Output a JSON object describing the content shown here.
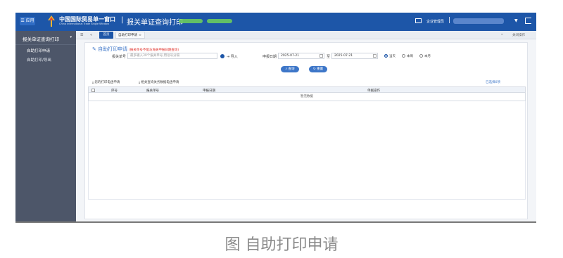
{
  "topbar": {
    "menu_label": "应用",
    "brand_cn": "中国国际贸易单一窗口",
    "brand_en": "China International Trade Single Window",
    "separator": "|",
    "module_title": "报关单证查询打印",
    "admin_label": "企业管理员",
    "separator2": "|",
    "caret": "▼"
  },
  "sidebar": {
    "heading": "报关单证查询打印",
    "items": [
      {
        "label": "自助打印申请"
      },
      {
        "label": "自助打印/导出"
      }
    ]
  },
  "tabbar": {
    "home_tab": "首页",
    "current_tab": "自助打印申请",
    "close_all": "关闭操作",
    "prev": "«",
    "next": "»"
  },
  "form": {
    "title": "自助打印申请",
    "note": "(报关单号不能与海关申报日期查询)",
    "decl_no_label": "报关单号",
    "decl_no_placeholder": "最多输入30个报关单号,用逗号分隔",
    "import_label": "导入",
    "date_label": "申报日期",
    "date_from": "2025-07-21",
    "date_to_label": "至",
    "date_to": "2025-07-21",
    "radio_options": [
      "当天",
      "本周",
      "本月"
    ],
    "radio_selected": "当天",
    "search_btn": "查询",
    "reset_btn": "重置"
  },
  "toolbar": {
    "links": [
      "您的打印电函申请",
      "相关查询关务数据电函申请"
    ],
    "selected_label": "已选择0项"
  },
  "table": {
    "columns": [
      "序号",
      "报关单号",
      "申报日期",
      "单据操作"
    ],
    "empty_text": "暂无数据"
  },
  "caption": "图 自助打印申请",
  "colors": {
    "primary": "#1d56a8",
    "sidebar": "#4d5669",
    "accent": "#3d76c8"
  }
}
